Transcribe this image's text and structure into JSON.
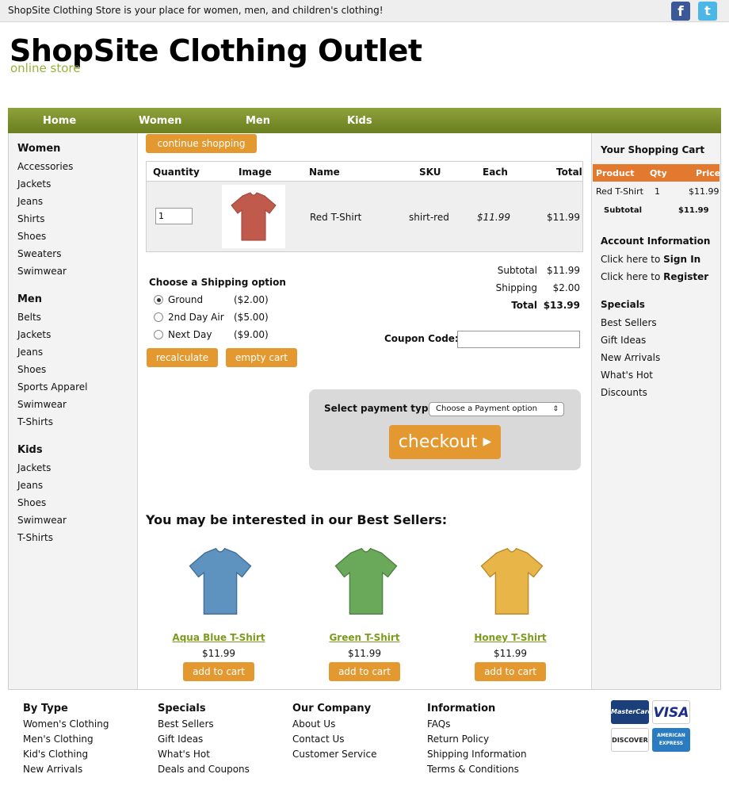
{
  "topbar": {
    "tagline": "ShopSite Clothing Store is your place for women, men, and children's clothing!"
  },
  "header": {
    "title": "ShopSite Clothing Outlet",
    "subtitle": "online store"
  },
  "nav": [
    "Home",
    "Women",
    "Men",
    "Kids"
  ],
  "sidebar": {
    "women": {
      "title": "Women",
      "items": [
        "Accessories",
        "Jackets",
        "Jeans",
        "Shirts",
        "Shoes",
        "Sweaters",
        "Swimwear"
      ]
    },
    "men": {
      "title": "Men",
      "items": [
        "Belts",
        "Jackets",
        "Jeans",
        "Shoes",
        "Sports Apparel",
        "Swimwear",
        "T-Shirts"
      ]
    },
    "kids": {
      "title": "Kids",
      "items": [
        "Jackets",
        "Jeans",
        "Shoes",
        "Swimwear",
        "T-Shirts"
      ]
    }
  },
  "cart": {
    "continue_label": "continue shopping",
    "headers": [
      "Quantity",
      "Image",
      "Name",
      "SKU",
      "Each",
      "Total"
    ],
    "item": {
      "quantity": "1",
      "name": "Red T-Shirt",
      "sku": "shirt-red",
      "each": "$11.99",
      "total": "$11.99"
    }
  },
  "shipping": {
    "title": "Choose a Shipping option",
    "options": [
      {
        "label": "Ground",
        "price": "($2.00)",
        "selected": true
      },
      {
        "label": "2nd Day Air",
        "price": "($5.00)",
        "selected": false
      },
      {
        "label": "Next Day",
        "price": "($9.00)",
        "selected": false
      }
    ],
    "recalculate_label": "recalculate",
    "empty_label": "empty cart"
  },
  "summary": {
    "subtotal_label": "Subtotal",
    "subtotal": "$11.99",
    "shipping_label": "Shipping",
    "shipping": "$2.00",
    "total_label": "Total",
    "total": "$13.99",
    "coupon_label": "Coupon Code:"
  },
  "payment": {
    "label": "Select payment type:",
    "selected": "Choose a Payment option",
    "checkout_label": "checkout"
  },
  "bestsellers": {
    "title": "You may be interested in our Best Sellers:",
    "products": [
      {
        "name": "Aqua Blue T-Shirt",
        "price": "$11.99",
        "button": "add to cart",
        "color": "#5d93be"
      },
      {
        "name": "Green T-Shirt",
        "price": "$11.99",
        "button": "add to cart",
        "color": "#6aa95a"
      },
      {
        "name": "Honey T-Shirt",
        "price": "$11.99",
        "button": "add to cart",
        "color": "#e7b548"
      }
    ]
  },
  "right": {
    "cart_title": "Your Shopping Cart",
    "cart_headers": [
      "Product",
      "Qty",
      "Price"
    ],
    "cart_item": {
      "product": "Red T-Shirt",
      "qty": "1",
      "price": "$11.99"
    },
    "subtotal_label": "Subtotal",
    "subtotal": "$11.99",
    "account_title": "Account Information",
    "signin_prefix": "Click here to ",
    "signin": "Sign In",
    "register_prefix": "Click here to ",
    "register": "Register",
    "specials_title": "Specials",
    "specials": [
      "Best Sellers",
      "Gift Ideas",
      "New Arrivals",
      "What's Hot",
      "Discounts"
    ]
  },
  "footer": {
    "by_type": {
      "title": "By Type",
      "items": [
        "Women's Clothing",
        "Men's Clothing",
        "Kid's Clothing",
        "New Arrivals"
      ]
    },
    "specials": {
      "title": "Specials",
      "items": [
        "Best Sellers",
        "Gift Ideas",
        "What's Hot",
        "Deals and Coupons"
      ]
    },
    "company": {
      "title": "Our Company",
      "items": [
        "About Us",
        "Contact Us",
        "Customer Service"
      ]
    },
    "info": {
      "title": "Information",
      "items": [
        "FAQs",
        "Return Policy",
        "Shipping Information",
        "Terms & Conditions"
      ]
    },
    "cards": [
      "MasterCard",
      "VISA",
      "DISCOVER",
      "AMERICAN EXPRESS"
    ]
  },
  "colors": {
    "nav": "#7b8f2b",
    "accent": "#e3992f",
    "cart_header": "#e3782f",
    "link_green": "#7e9a1d",
    "red_shirt": "#c05a4c"
  }
}
